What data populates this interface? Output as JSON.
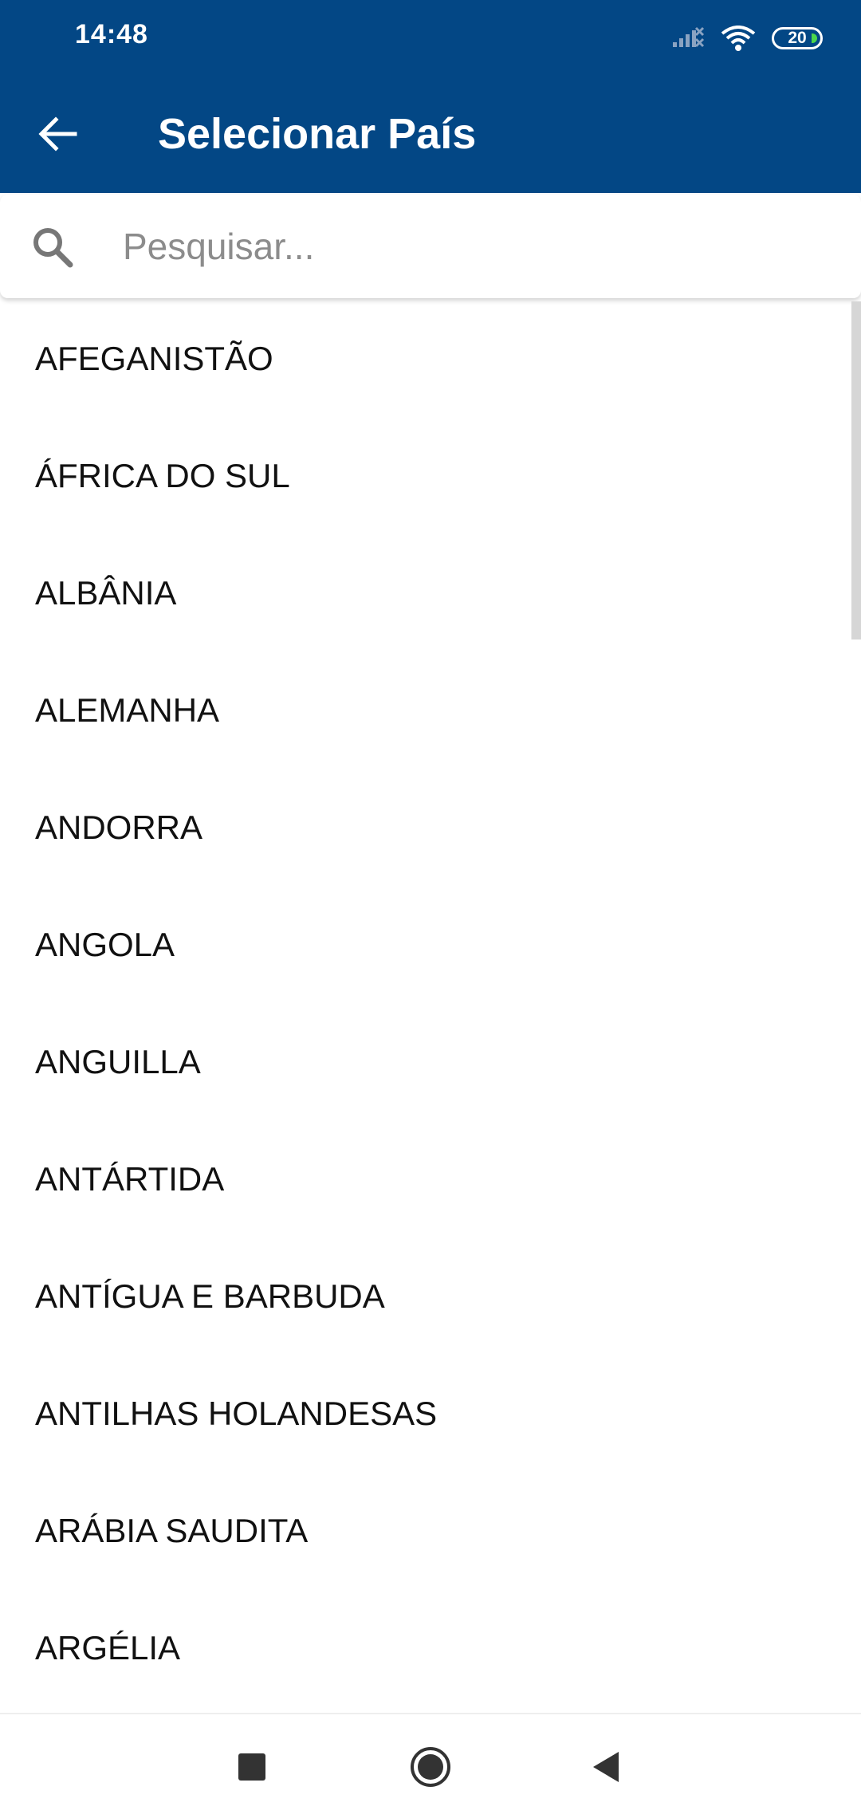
{
  "status_bar": {
    "time": "14:48",
    "battery_level": "20",
    "icons": [
      "signal-off-icon",
      "wifi-icon",
      "battery-icon"
    ]
  },
  "app_bar": {
    "title": "Selecionar País",
    "back_icon": "arrow-back-icon"
  },
  "search": {
    "placeholder": "Pesquisar...",
    "value": "",
    "icon": "search-icon"
  },
  "countries": [
    "AFEGANISTÃO",
    "ÁFRICA DO SUL",
    "ALBÂNIA",
    "ALEMANHA",
    "ANDORRA",
    "ANGOLA",
    "ANGUILLA",
    "ANTÁRTIDA",
    "ANTÍGUA E BARBUDA",
    "ANTILHAS HOLANDESAS",
    "ARÁBIA SAUDITA",
    "ARGÉLIA"
  ],
  "nav_bar": {
    "buttons": [
      "recents-square-icon",
      "home-circle-icon",
      "back-triangle-icon"
    ]
  },
  "colors": {
    "primary": "#034785",
    "text": "#111111",
    "placeholder": "#8c8c8c",
    "battery_accent": "#4cd64c"
  }
}
